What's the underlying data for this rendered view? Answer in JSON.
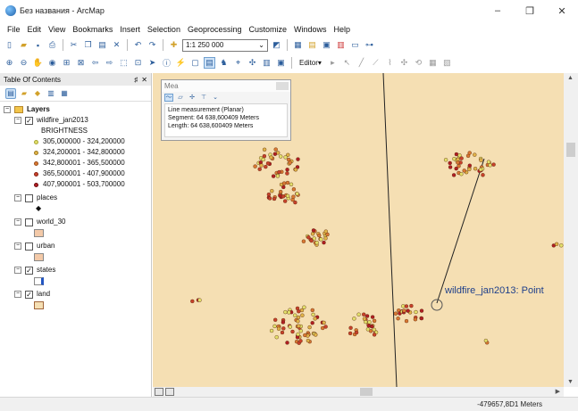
{
  "window": {
    "title": "Без названия - ArcMap",
    "controls": [
      "–",
      "❐",
      "✕"
    ]
  },
  "menu": [
    "File",
    "Edit",
    "View",
    "Bookmarks",
    "Insert",
    "Selection",
    "Geoprocessing",
    "Customize",
    "Windows",
    "Help"
  ],
  "toolbar": {
    "scale": "1:1 250 000",
    "editor_label": "Editor▾"
  },
  "toc": {
    "title": "Table Of Contents",
    "pin": "♯",
    "close": "✕",
    "root": "Layers",
    "layers": [
      {
        "name": "wildfire_jan2013",
        "checked": true,
        "field": "BRIGHTNESS",
        "classes": [
          {
            "label": "305,000000 - 324,200000",
            "color": "#e2e06a"
          },
          {
            "label": "324,200001 - 342,800000",
            "color": "#e0b348"
          },
          {
            "label": "342,800001 - 365,500000",
            "color": "#d97832"
          },
          {
            "label": "365,500001 - 407,900000",
            "color": "#c8412a"
          },
          {
            "label": "407,900001 - 503,700000",
            "color": "#b01e22"
          }
        ]
      },
      {
        "name": "places",
        "checked": false
      },
      {
        "name": "world_30",
        "checked": false
      },
      {
        "name": "urban",
        "checked": false
      },
      {
        "name": "states",
        "checked": true
      },
      {
        "name": "land",
        "checked": true
      }
    ]
  },
  "measure": {
    "title": "Mea",
    "line1": "Line measurement (Planar)",
    "line2": "Segment: 64 638,600409 Meters",
    "line3": "Length: 64 638,600409 Meters"
  },
  "map": {
    "feature_label": "wildfire_jan2013: Point",
    "land_color": "#f5dfb3"
  },
  "status": {
    "coordinates": "-479657,8D1 Meters"
  }
}
